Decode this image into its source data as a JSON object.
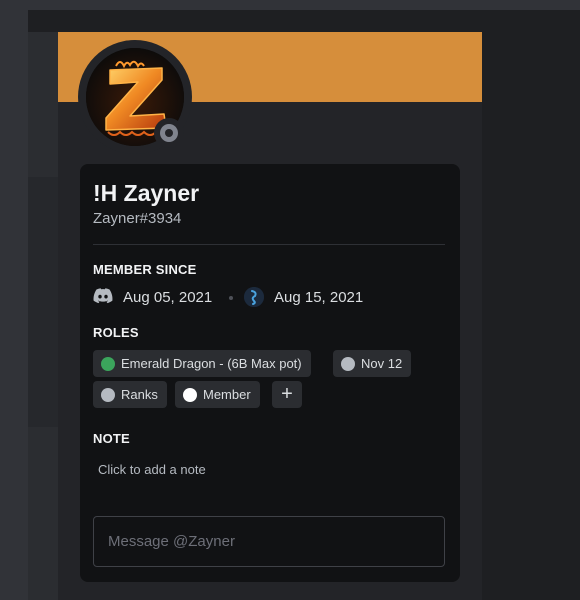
{
  "colors": {
    "banner": "#d68e3b",
    "status_offline": "#80848e",
    "role_emerald": "#3ba55c",
    "role_grey": "#b5bac1",
    "role_white": "#ffffff"
  },
  "profile": {
    "display_name": "!H Zayner",
    "username": "Zayner#3934",
    "avatar_icon": "flaming-z-avatar",
    "status": "offline"
  },
  "member_since": {
    "title": "MEMBER SINCE",
    "discord_icon": "discord-logo-icon",
    "discord_date": "Aug 05, 2021",
    "server_icon": "server-icon",
    "server_date": "Aug 15, 2021"
  },
  "roles": {
    "title": "ROLES",
    "items": [
      {
        "label": "Emerald Dragon - (6B Max pot)",
        "color": "#3ba55c"
      },
      {
        "label": "Nov 12",
        "color": "#b5bac1"
      },
      {
        "label": "Ranks",
        "color": "#b5bac1"
      },
      {
        "label": "Member",
        "color": "#ffffff"
      }
    ],
    "add_label": "+"
  },
  "note": {
    "title": "NOTE",
    "placeholder": "Click to add a note"
  },
  "message": {
    "placeholder": "Message @Zayner"
  }
}
